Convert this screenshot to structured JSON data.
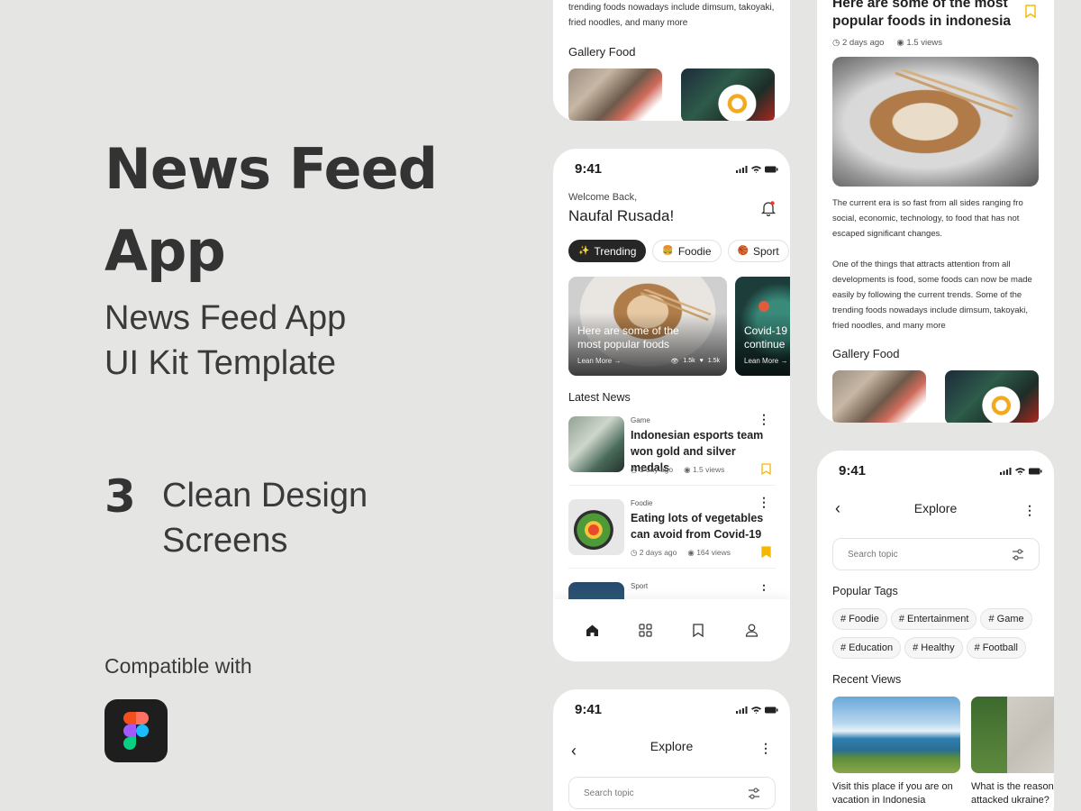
{
  "promo": {
    "title_line1": "News Feed",
    "title_line2": "App",
    "subtitle_line1": "News Feed App",
    "subtitle_line2": "UI Kit Template",
    "screens_count": "3",
    "feature_line1": "Clean Design",
    "feature_line2": "Screens",
    "compatible": "Compatible with",
    "tool_icon": "figma-logo"
  },
  "status_time": "9:41",
  "detail_top": {
    "body_tail": "trending foods nowadays include dimsum, takoyaki, fried noodles, and many more",
    "gallery_title": "Gallery Food"
  },
  "home": {
    "welcome": "Welcome Back,",
    "user_name": "Naufal Rusada!",
    "categories": [
      {
        "icon": "sparkles-icon",
        "glyph": "✨",
        "label": "Trending"
      },
      {
        "icon": "burger-icon",
        "glyph": "🍔",
        "label": "Foodie"
      },
      {
        "icon": "basketball-icon",
        "glyph": "🏀",
        "label": "Sport"
      }
    ],
    "featured": [
      {
        "title": "Here are some of the most popular foods",
        "cta": "Lean More",
        "views": "1.5k",
        "likes": "1.5k"
      },
      {
        "title": "Covid-19 continue",
        "cta": "Lean More"
      }
    ],
    "latest_title": "Latest News",
    "news": [
      {
        "category": "Game",
        "title": "Indonesian esports team won gold and silver medals",
        "time": "1 day ago",
        "views": "1.5 views",
        "saved": false
      },
      {
        "category": "Foodie",
        "title": "Eating lots of vegetables can avoid from Covid-19",
        "time": "2 days ago",
        "views": "164 views",
        "saved": true
      },
      {
        "category": "Sport",
        "title": "",
        "time": "",
        "views": "",
        "saved": false
      }
    ],
    "nav": [
      "home-icon",
      "grid-icon",
      "bookmark-icon",
      "profile-icon"
    ]
  },
  "explore_bottom": {
    "title": "Explore",
    "search_placeholder": "Search topic"
  },
  "detail_right": {
    "headline_line1": "Here are some of the most",
    "headline_line2": "popular foods in indonesia",
    "time": "2 days ago",
    "views": "1.5 views",
    "para1_l1": "The current era is so fast from all sides ranging fro",
    "para1_l2": "social, economic, technology, to food that has not",
    "para1_l3": "escaped significant changes.",
    "para2_l1": "One of the things that attracts attention from all",
    "para2_l2": "developments is food, some foods can now be made",
    "para2_l3": "easily by following the current trends. Some of the",
    "para2_l4": "trending foods nowadays include dimsum, takoyaki,",
    "para2_l5": "fried noodles, and many more",
    "gallery_title": "Gallery Food"
  },
  "explore_right": {
    "title": "Explore",
    "search_placeholder": "Search topic",
    "popular_title": "Popular Tags",
    "tags_row1": [
      "# Foodie",
      "# Entertainment",
      "# Game"
    ],
    "tags_row2": [
      "# Education",
      "# Healthy",
      "# Football"
    ],
    "recent_title": "Recent Views",
    "recent": [
      {
        "title_l1": "Visit this place if you are on",
        "title_l2": "vacation in Indonesia"
      },
      {
        "title_l1": "What is the reason",
        "title_l2": "attacked ukraine?"
      }
    ]
  },
  "colors": {
    "background": "#e5e6e4",
    "accent": "#f5b800",
    "dark": "#262626",
    "notification": "#e53935"
  }
}
